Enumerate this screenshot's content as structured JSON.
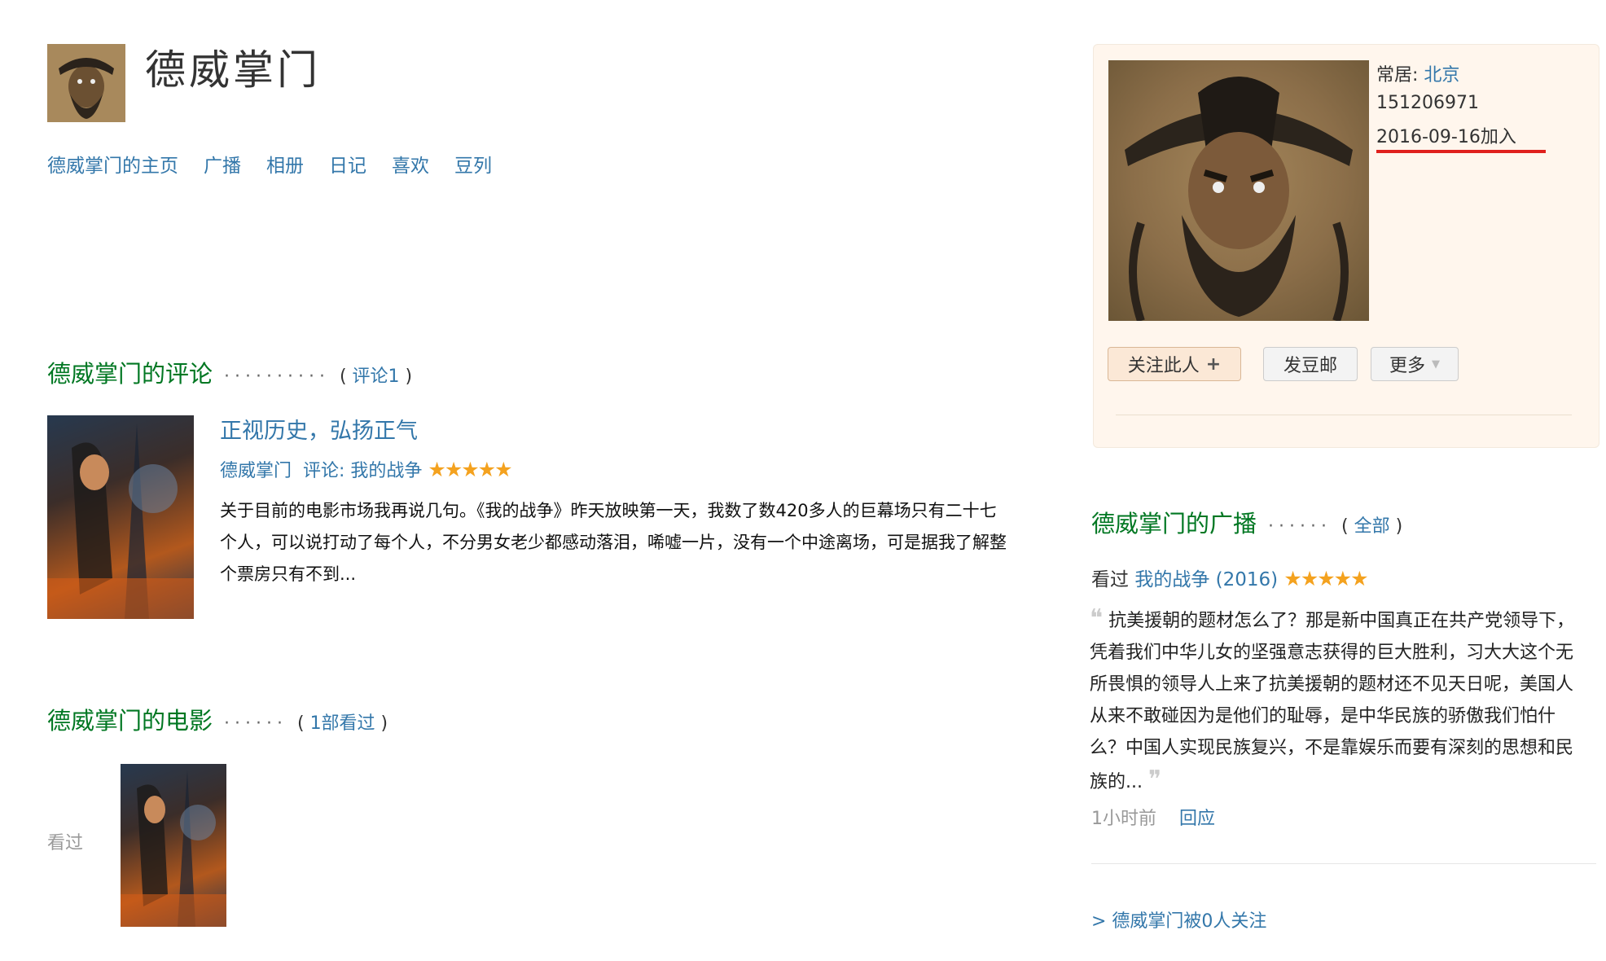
{
  "profile": {
    "name": "德威掌门",
    "nav": [
      "德威掌门的主页",
      "广播",
      "相册",
      "日记",
      "喜欢",
      "豆列"
    ]
  },
  "reviews_section": {
    "title": "德威掌门的评论",
    "dots": "··········",
    "count_label": "评论1",
    "review": {
      "title": "正视历史，弘扬正气",
      "author": "德威掌门",
      "meta_label": "评论: 我的战争",
      "rating_stars": 5,
      "stars_text": "★★★★★",
      "body": "关于目前的电影市场我再说几句。《我的战争》昨天放映第一天，我数了数420多人的巨幕场只有二十七个人，可以说打动了每个人，不分男女老少都感动落泪，唏嘘一片，没有一个中途离场，可是据我了解整个票房只有不到..."
    }
  },
  "movies_section": {
    "title": "德威掌门的电影",
    "dots": "······",
    "count_label": "1部看过",
    "seen_label": "看过"
  },
  "sidebar": {
    "residence_label": "常居: ",
    "residence_city": "北京",
    "user_id": "151206971",
    "join_date": "2016-09-16加入",
    "buttons": {
      "follow": "关注此人",
      "follow_icon": "+",
      "mail": "发豆邮",
      "more": "更多"
    }
  },
  "broadcast_section": {
    "title": "德威掌门的广播",
    "dots": "······",
    "all_label": "全部",
    "item": {
      "verb": "看过",
      "movie": "我的战争 (2016)",
      "rating_stars": 5,
      "stars_text": "★★★★★",
      "quote": "抗美援朝的题材怎么了？那是新中国真正在共产党领导下，凭着我们中华儿女的坚强意志获得的巨大胜利，习大大这个无所畏惧的领导人上来了抗美援朝的题材还不见天日呢，美国人从来不敢碰因为是他们的耻辱，是中华民族的骄傲我们怕什么？中国人实现民族复兴，不是靠娱乐而要有深刻的思想和民族的...",
      "open_quote": "❝",
      "close_quote": "❞",
      "time": "1小时前",
      "reply": "回应"
    },
    "followers": "> 德威掌门被0人关注"
  },
  "colors": {
    "link": "#3377aa",
    "green_title": "#007722",
    "star": "#f4a21f",
    "card_bg": "#fff6ed",
    "underline": "#e0201c"
  }
}
